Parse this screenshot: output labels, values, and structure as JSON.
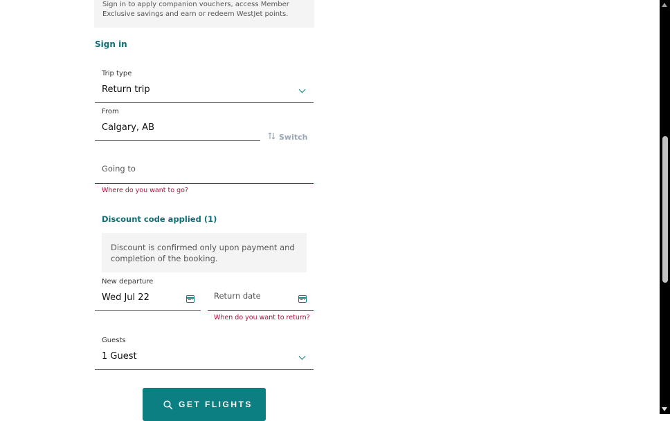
{
  "signin_info": "Sign in to apply companion vouchers, access Member Exclusive savings and earn or redeem WestJet points.",
  "sign_in_link": "Sign in",
  "trip_type": {
    "label": "Trip type",
    "value": "Return trip"
  },
  "from": {
    "label": "From",
    "value": "Calgary, AB"
  },
  "switch_label": "Switch",
  "going_to": {
    "placeholder": "Going to",
    "error": "Where do you want to go?"
  },
  "discount": {
    "link": "Discount code applied (1)",
    "notice": "Discount is confirmed only upon payment and completion of the booking."
  },
  "departure": {
    "label": "New departure",
    "value": "Wed Jul 22"
  },
  "return_date": {
    "placeholder": "Return date",
    "error": "When do you want to return?"
  },
  "guests": {
    "label": "Guests",
    "value": "1 Guest"
  },
  "submit_label": "GET FLIGHTS",
  "colors": {
    "accent": "#0b7f82",
    "error": "#a8123e",
    "link": "#0b6f73"
  }
}
